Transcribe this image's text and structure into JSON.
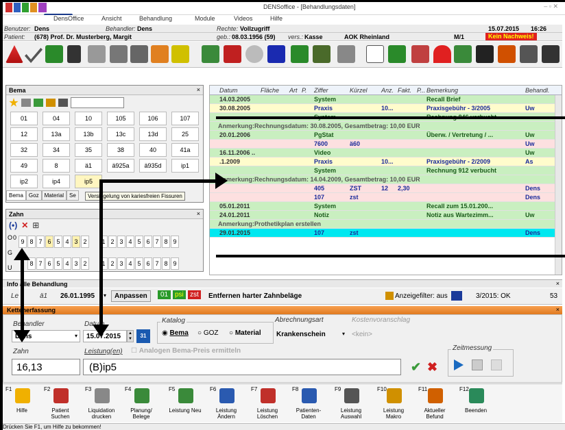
{
  "window": {
    "title": "DENSoffice - [Behandlungsdaten]",
    "controls": "‒ ▫ ✕"
  },
  "menu": {
    "items": [
      "DensOffice",
      "Ansicht",
      "Behandlung",
      "Module",
      "Videos",
      "Hilfe"
    ]
  },
  "info1": {
    "benutzer_label": "Benutzer:",
    "benutzer": "Dens",
    "behandler_label": "Behandler:",
    "behandler": "Dens",
    "rechte_label": "Rechte:",
    "rechte": "Vollzugriff",
    "date": "15.07.2015",
    "time": "16:26"
  },
  "info2": {
    "patient_label": "Patient:",
    "patient": "(678) Prof. Dr. Musterberg, Margit",
    "geb_label": "geb.:",
    "geb": "08.03.1956 (59)",
    "vers_label": "vers.:",
    "vers": "Kasse",
    "kasse": "AOK Rheinland",
    "m": "M/1",
    "nachweis": "Kein Nachweis!"
  },
  "bema": {
    "title": "Bema",
    "close": "×",
    "buttons": [
      "01",
      "04",
      "10",
      "105",
      "106",
      "107",
      "12",
      "13a",
      "13b",
      "13c",
      "13d",
      "25",
      "32",
      "34",
      "35",
      "38",
      "40",
      "41a",
      "49",
      "8",
      "ä1",
      "ä925a",
      "ä935d",
      "ip1",
      "ip2",
      "ip4",
      "ip5"
    ],
    "tabs": [
      "Bema",
      "Goz",
      "Material",
      "Se"
    ],
    "tooltip": "Versiegelung von kariesfreien Fissuren"
  },
  "zahn": {
    "title": "Zahn",
    "close": "×",
    "upper_prefix": "O",
    "lower_prefix": "U",
    "g": "G",
    "upper_left": [
      "9",
      "8",
      "7",
      "6",
      "5",
      "4",
      "3",
      "2"
    ],
    "upper_right": [
      "1",
      "2",
      "3",
      "4",
      "5",
      "6",
      "7",
      "8",
      "9"
    ],
    "lower_left": [
      "8",
      "7",
      "6",
      "5",
      "4",
      "3",
      "2"
    ],
    "lower_right": [
      "1",
      "2",
      "3",
      "4",
      "5",
      "6",
      "7",
      "8",
      "9"
    ],
    "first_row_extra": "9",
    "zero": "0"
  },
  "grid": {
    "headers": [
      "Datum",
      "Fläche",
      "Art",
      "P.",
      "Ziffer",
      "Kürzel",
      "Anz.",
      "Fakt.",
      "P...",
      "Bemerkung",
      "Behandl."
    ],
    "rows": [
      {
        "datum": "14.03.2005",
        "ziffer": "System",
        "bem": "Recall Brief",
        "beh": "",
        "bg": "#c9efc0"
      },
      {
        "datum": "30.08.2005",
        "ziffer": "Praxis",
        "anz": "10...",
        "bem": "Praxisgebühr - 3/2005",
        "beh": "Uw",
        "bg": "#fffccc"
      },
      {
        "datum": "",
        "ziffer": "System",
        "bem": "Rechnung 846 verbucht",
        "beh": "",
        "bg": "#c9efc0"
      },
      {
        "note": "Anmerkung:Rechnungsdatum: 30.08.2005, Gesamtbetrag: 10,00 EUR",
        "bg": "#c9efc0"
      },
      {
        "datum": "20.01.2006",
        "ziffer": "PgStat",
        "bem": "Überw. / Vertretung / ...",
        "beh": "Uw",
        "bg": "#c9efc0"
      },
      {
        "datum": "",
        "ziffer": "7600",
        "kuerzel": "ä60",
        "beh": "Uw",
        "bg": "#fde0e0"
      },
      {
        "datum": "16.11.2006 ..",
        "ziffer": "Video",
        "beh": "Uw",
        "bg": "#c9efc0"
      },
      {
        "datum": ".1.2009",
        "ziffer": "Praxis",
        "anz": "10...",
        "bem": "Praxisgebühr - 2/2009",
        "beh": "As",
        "bg": "#fffccc"
      },
      {
        "datum": "",
        "ziffer": "System",
        "bem": "Rechnung 912 verbucht",
        "beh": "",
        "bg": "#c9efc0"
      },
      {
        "note": "Anmerkung:Rechnungsdatum: 14.04.2009, Gesamtbetrag: 10,00 EUR",
        "bg": "#c9efc0"
      },
      {
        "datum": "",
        "ziffer": "405",
        "kuerzel": "ZST",
        "anz": "12",
        "fakt": "2,30",
        "beh": "Dens",
        "bg": "#fde0e0"
      },
      {
        "datum": "",
        "ziffer": "107",
        "kuerzel": "zst",
        "beh": "Dens",
        "bg": "#fde0e0"
      },
      {
        "datum": "05.01.2011",
        "ziffer": "System",
        "bem": "Recall zum 15.01.200...",
        "beh": "",
        "bg": "#c9efc0"
      },
      {
        "datum": "24.01.2011",
        "ziffer": "Notiz",
        "bem": "Notiz aus Wartezimm...",
        "beh": "Uw",
        "bg": "#c9efc0"
      },
      {
        "note": "Anmerkung:Prothetikplan erstellen",
        "bg": "#c9efc0"
      },
      {
        "datum": "29.01.2015",
        "ziffer": "107",
        "kuerzel": "zst",
        "beh": "Dens",
        "bg": "#00e8f0"
      }
    ]
  },
  "info_behandlung": {
    "title": "Info alle Behandlung",
    "close": "×",
    "leis_label": "Le",
    "leis": "ä1",
    "date": "26.01.1995",
    "anpassen": "Anpassen",
    "b01": "01",
    "psi": "psi",
    "zst": "zst",
    "desc": "Entfernen harter Zahnbeläge",
    "filter": "Anzeigefilter: aus",
    "quartal": "3/2015: OK",
    "num": "53"
  },
  "erfassung": {
    "title": "Kettenerfassung",
    "close": "×",
    "behandler_label": "Behandler",
    "behandler": "Dens",
    "datum_label": "Datum",
    "datum": "15.07.2015",
    "katalog_label": "Katalog",
    "katalog_options": [
      "Bema",
      "GOZ",
      "Material"
    ],
    "abrechnung_label": "Abrechnungsart",
    "abrechnung": "Krankenschein",
    "kv_label": "Kostenvoranschlag",
    "kv": "<kein>",
    "zahn_label": "Zahn",
    "leistung_label": "Leistung(en)",
    "analog_label": "Analogen Bema-Preis ermitteln",
    "zeitmessung_label": "Zeitmessung",
    "zahn_value": "16,13",
    "leistung_value": "(B)ip5"
  },
  "fkeys": [
    {
      "n": "F1",
      "t": "Hilfe",
      "c": "#f0b000"
    },
    {
      "n": "F2",
      "t": "Patient Suchen",
      "c": "#c0302a"
    },
    {
      "n": "F3",
      "t": "Liquidation drucken",
      "c": "#888888"
    },
    {
      "n": "F4",
      "t": "Planung/ Belege",
      "c": "#3a8a3a"
    },
    {
      "n": "F5",
      "t": "Leistung Neu",
      "c": "#3a8a3a"
    },
    {
      "n": "F6",
      "t": "Leistung Ändern",
      "c": "#2a5ab0"
    },
    {
      "n": "F7",
      "t": "Leistung Löschen",
      "c": "#c0302a"
    },
    {
      "n": "F8",
      "t": "Patienten- Daten",
      "c": "#2a5ab0"
    },
    {
      "n": "F9",
      "t": "Leistung Auswahl",
      "c": "#555555"
    },
    {
      "n": "F10",
      "t": "Leistung Makro",
      "c": "#d09000"
    },
    {
      "n": "F11",
      "t": "Aktueller Befund",
      "c": "#d06000"
    },
    {
      "n": "F12",
      "t": "Beenden",
      "c": "#2a8a5a"
    }
  ],
  "status": {
    "text": "Drücken Sie F1, um Hilfe zu bekommen!"
  }
}
